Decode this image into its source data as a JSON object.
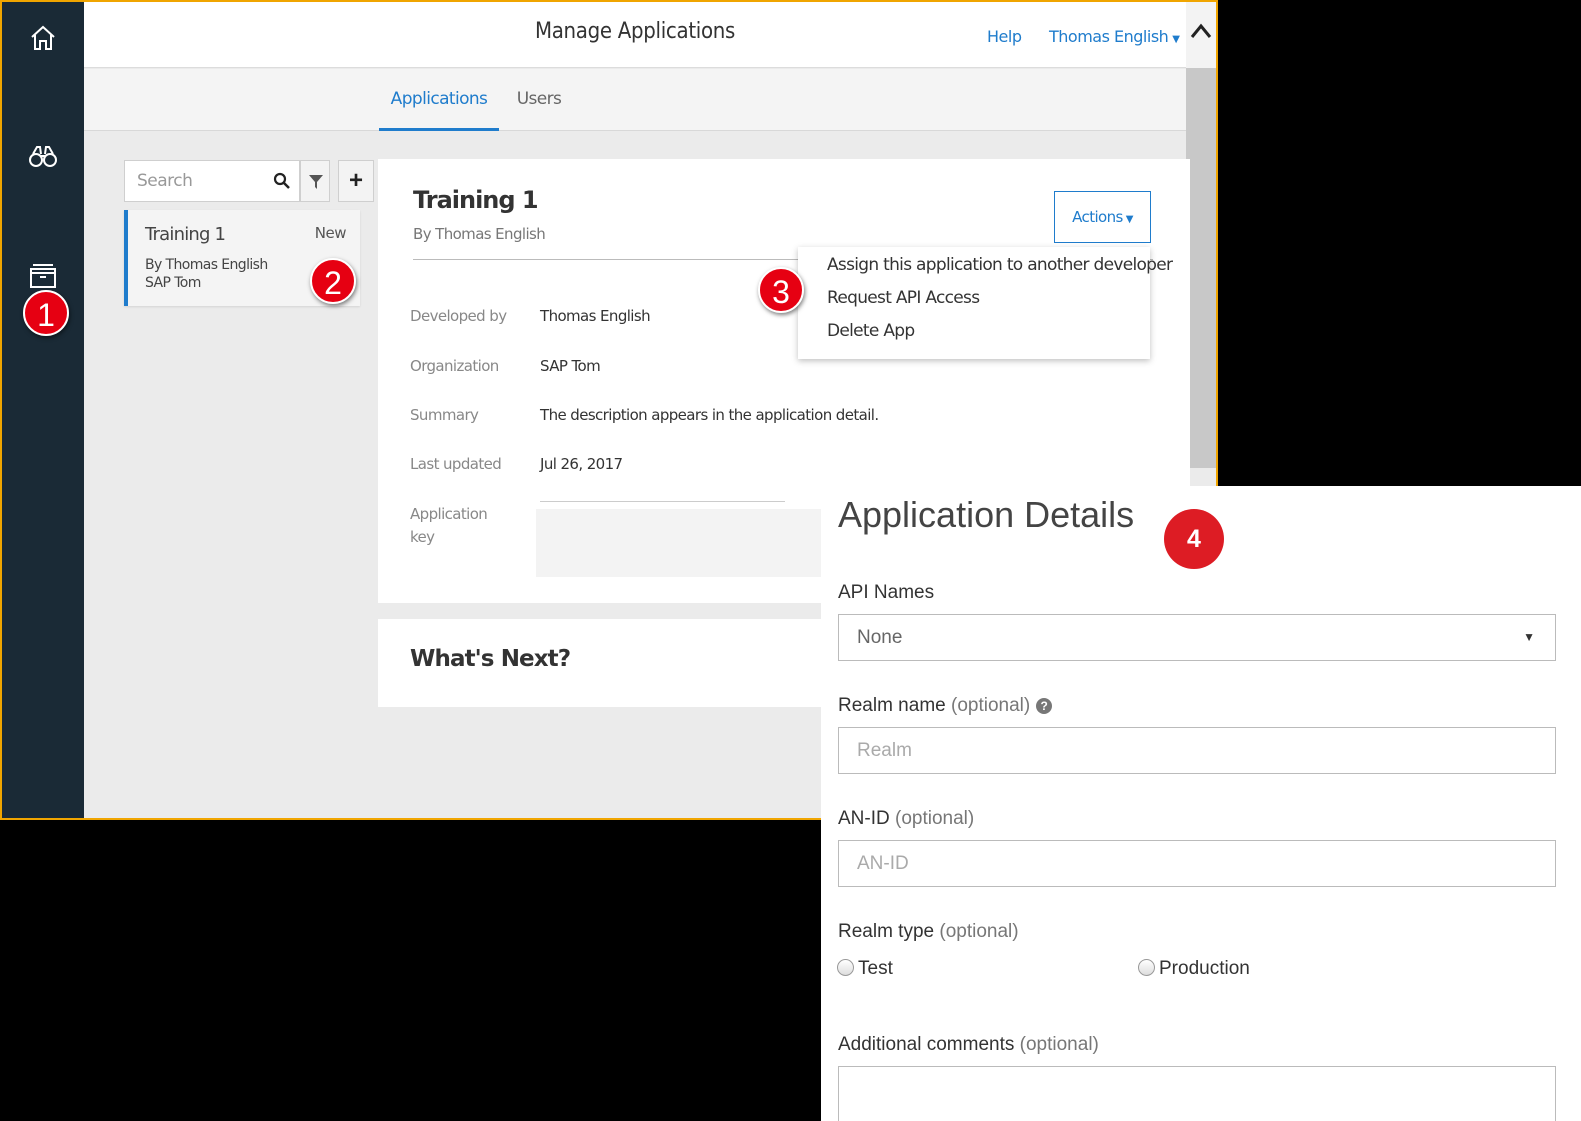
{
  "header": {
    "title": "Manage Applications",
    "help": "Help",
    "user": "Thomas English"
  },
  "tabs": {
    "applications": "Applications",
    "users": "Users"
  },
  "sidebar": {
    "search_placeholder": "Search",
    "card": {
      "title": "Training 1",
      "status": "New",
      "by": "By Thomas English",
      "org": "SAP Tom"
    }
  },
  "detail": {
    "title": "Training 1",
    "author": "By Thomas English",
    "actions_label": "Actions",
    "fields": {
      "developed_by_label": "Developed by",
      "developed_by": "Thomas English",
      "organization_label": "Organization",
      "organization": "SAP Tom",
      "summary_label": "Summary",
      "summary": "The description appears in the application detail.",
      "last_updated_label": "Last updated",
      "last_updated": "Jul 26, 2017",
      "app_key_label_line1": "Application",
      "app_key_label_line2": "key"
    },
    "menu": {
      "assign": "Assign this application to another developer",
      "request": "Request API Access",
      "delete": "Delete App"
    },
    "next_title": "What's Next?"
  },
  "badges": {
    "one": "1",
    "two": "2",
    "three": "3",
    "four": "4"
  },
  "form": {
    "title": "Application Details",
    "api_names_label": "API Names",
    "api_names_value": "None",
    "realm_name_label": "Realm name",
    "realm_name_opt": "(optional)",
    "realm_placeholder": "Realm",
    "anid_label": "AN-ID",
    "anid_opt": "(optional)",
    "anid_placeholder": "AN-ID",
    "realm_type_label": "Realm type",
    "realm_type_opt": "(optional)",
    "radio_test": "Test",
    "radio_production": "Production",
    "comments_label": "Additional comments",
    "comments_opt": "(optional)"
  },
  "colors": {
    "rail": "#1a2a36",
    "accent": "#1f7ccc",
    "window_border": "#f0a500",
    "badge": "#e60012"
  }
}
